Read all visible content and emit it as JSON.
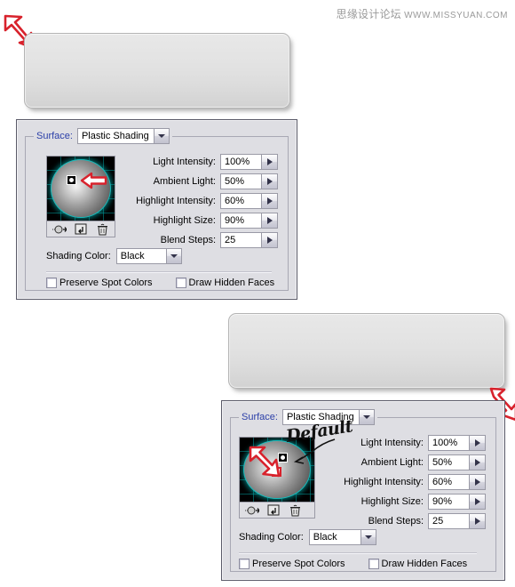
{
  "watermark": {
    "cn": "思缘设计论坛",
    "url": "WWW.MISSYUAN.COM"
  },
  "panels": [
    {
      "id": "panel-one",
      "surface_label": "Surface:",
      "surface_value": "Plastic Shading",
      "params": [
        {
          "label": "Light Intensity:",
          "value": "100%"
        },
        {
          "label": "Ambient Light:",
          "value": "50%"
        },
        {
          "label": "Highlight Intensity:",
          "value": "60%"
        },
        {
          "label": "Highlight Size:",
          "value": "90%"
        },
        {
          "label": "Blend Steps:",
          "value": "25"
        }
      ],
      "shading_color_label": "Shading Color:",
      "shading_color_value": "Black",
      "checkboxes": [
        {
          "label": "Preserve Spot Colors",
          "checked": false
        },
        {
          "label": "Draw Hidden Faces",
          "checked": false
        }
      ]
    },
    {
      "id": "panel-two",
      "surface_label": "Surface:",
      "surface_value": "Plastic Shading",
      "annotation": "Default",
      "params": [
        {
          "label": "Light Intensity:",
          "value": "100%"
        },
        {
          "label": "Ambient Light:",
          "value": "50%"
        },
        {
          "label": "Highlight Intensity:",
          "value": "60%"
        },
        {
          "label": "Highlight Size:",
          "value": "90%"
        },
        {
          "label": "Blend Steps:",
          "value": "25"
        }
      ],
      "shading_color_label": "Shading Color:",
      "shading_color_value": "Black",
      "checkboxes": [
        {
          "label": "Preserve Spot Colors",
          "checked": false
        },
        {
          "label": "Draw Hidden Faces",
          "checked": false
        }
      ]
    }
  ],
  "icons": {
    "light_source": "light-source-icon",
    "new_light": "new-light-icon",
    "delete_light": "trash-icon",
    "dropdown": "chevron-down-icon",
    "stepper": "chevron-right-icon",
    "pointer_top": "red-arrow-down-right-icon",
    "pointer_bottom": "red-arrow-up-left-icon",
    "pointer_preview_one": "red-arrow-left-icon",
    "pointer_preview_two": "red-arrow-down-right-icon"
  },
  "colors": {
    "accent_blue": "#2b3fa8",
    "annotation_red": "#d8222c",
    "panel_bg": "#dedee3",
    "preview_grid": "#009696",
    "watermark_gray": "#9a9a9a"
  }
}
